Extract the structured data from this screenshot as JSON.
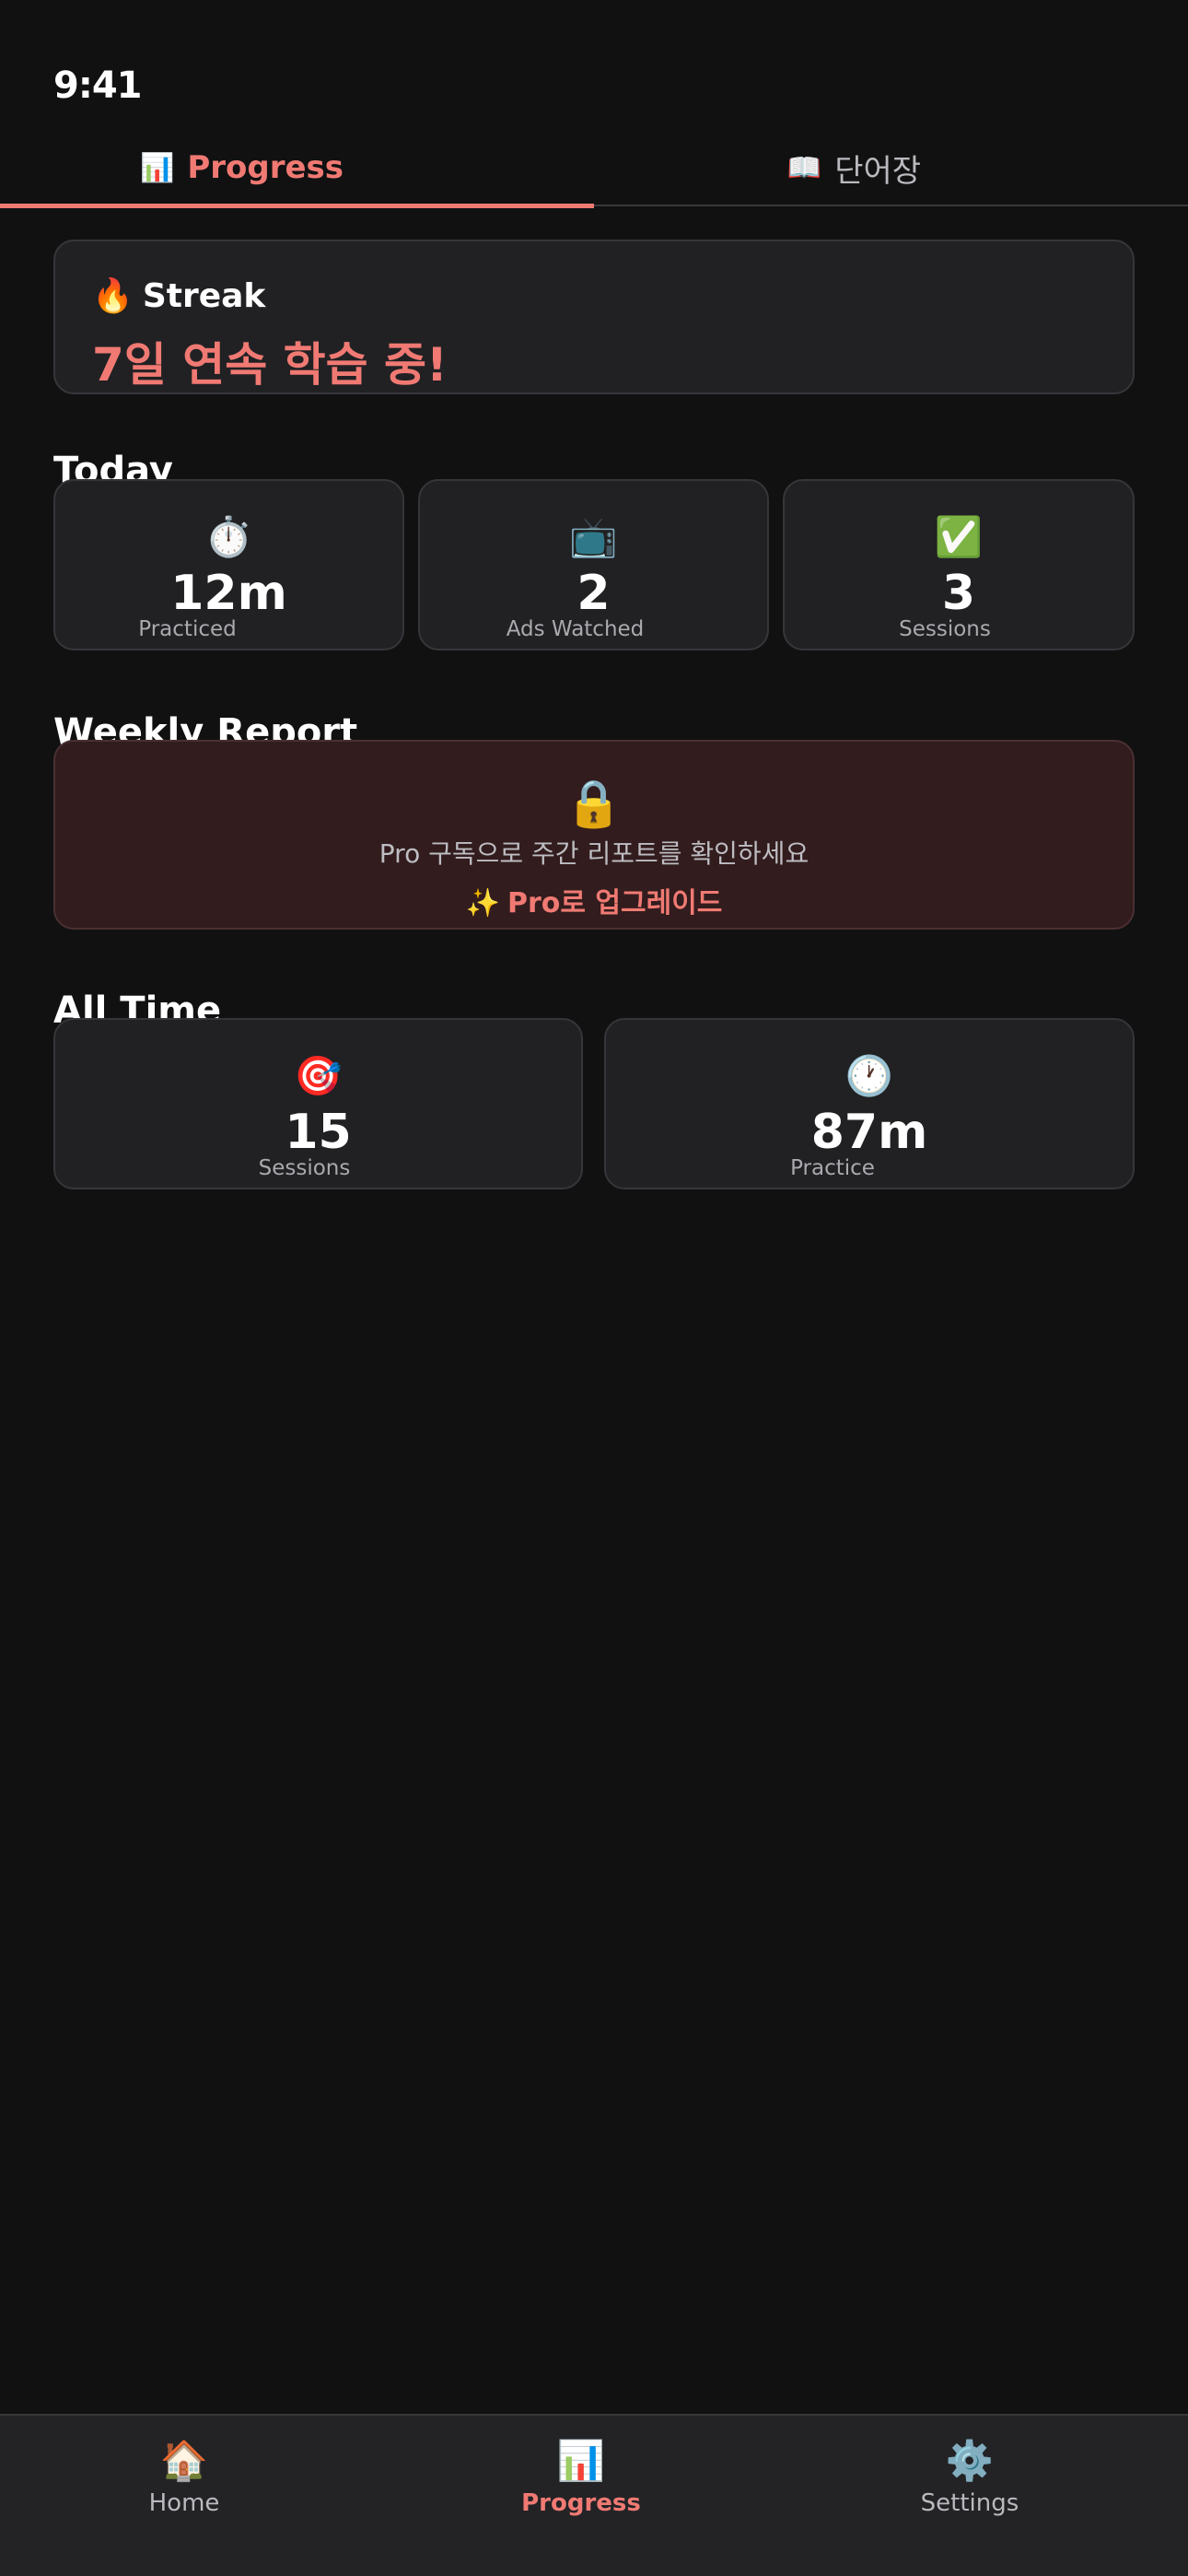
{
  "status_bar": {
    "time": "9:41"
  },
  "top_tabs": [
    {
      "icon": "📊",
      "label": "Progress",
      "active": true
    },
    {
      "icon": "📖",
      "label": "단어장",
      "active": false
    }
  ],
  "streak": {
    "icon": "🔥",
    "title": "Streak",
    "value": "7일 연속 학습 중!"
  },
  "today": {
    "title": "Today",
    "stats": [
      {
        "icon": "⏱️",
        "value": "12m",
        "label": "Practiced"
      },
      {
        "icon": "📺",
        "value": "2",
        "label": "Ads Watched"
      },
      {
        "icon": "✅",
        "value": "3",
        "label": "Sessions"
      }
    ]
  },
  "weekly_report": {
    "title": "Weekly Report",
    "lock_icon": "🔒",
    "message": "Pro 구독으로 주간 리포트를 확인하세요",
    "upgrade_icon": "✨",
    "upgrade_label": "Pro로 업그레이드"
  },
  "all_time": {
    "title": "All Time",
    "stats": [
      {
        "icon": "🎯",
        "value": "15",
        "label": "Sessions"
      },
      {
        "icon": "🕐",
        "value": "87m",
        "label": "Practice"
      }
    ]
  },
  "bottom_nav": [
    {
      "icon": "🏠",
      "label": "Home",
      "active": false
    },
    {
      "icon": "📊",
      "label": "Progress",
      "active": true
    },
    {
      "icon": "⚙️",
      "label": "Settings",
      "active": false
    }
  ],
  "colors": {
    "accent": "#f07a73",
    "background": "#111112",
    "card": "#212124",
    "pro_card": "#321c1d"
  }
}
